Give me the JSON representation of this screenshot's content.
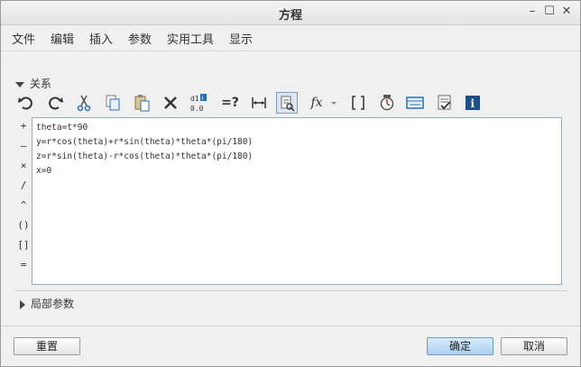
{
  "window": {
    "title": "方程",
    "minimize": "–",
    "maximize": "☐",
    "close": "✕"
  },
  "menu": {
    "items": [
      "文件",
      "编辑",
      "插入",
      "参数",
      "实用工具",
      "显示"
    ]
  },
  "relations": {
    "header": "关系",
    "operators": [
      "+",
      "–",
      "×",
      "/",
      "^",
      "()",
      "[]",
      "="
    ],
    "lines": [
      "theta=t*90",
      "y=r*cos(theta)+r*sin(theta)*theta*(pi/180)",
      "z=r*sin(theta)-r*cos(theta)*theta*(pi/180)",
      "x=0"
    ]
  },
  "toolbar": {
    "icons": [
      "undo-icon",
      "redo-icon",
      "cut-icon",
      "copy-icon",
      "paste-icon",
      "delete-icon",
      "display-values-icon",
      "evaluate-icon",
      "insert-dimension-icon",
      "sort-relations-icon",
      "function-icon",
      "brackets-icon",
      "execute-icon",
      "verify-icon",
      "checklist-icon",
      "info-icon"
    ],
    "fx_label": "fx",
    "eq_label": "=?",
    "dim_label": "d1",
    "dim_value": "0.0",
    "info_label": "i"
  },
  "local_params": {
    "label": "局部参数"
  },
  "buttons": {
    "reset": "重置",
    "ok": "确定",
    "cancel": "取消"
  },
  "colors": {
    "accent": "#1f4e8c",
    "ok_button": "#a9d0f1"
  }
}
